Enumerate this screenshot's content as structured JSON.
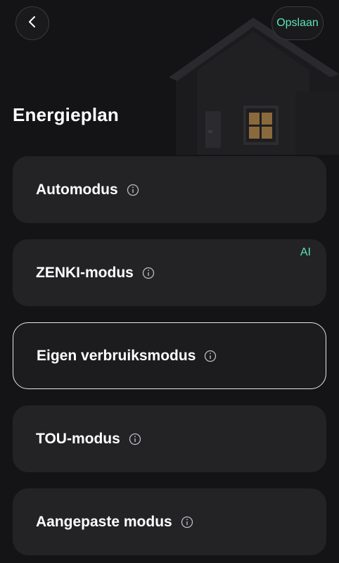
{
  "header": {
    "back_icon": "chevron-left-icon",
    "save_label": "Opslaan"
  },
  "page": {
    "title": "Energieplan"
  },
  "modes": [
    {
      "label": "Automodus",
      "icon": "info-icon",
      "selected": false
    },
    {
      "label": "ZENKI-modus",
      "icon": "info-icon",
      "badge": "AI",
      "selected": false
    },
    {
      "label": "Eigen verbruiksmodus",
      "icon": "info-icon",
      "selected": true
    },
    {
      "label": "TOU-modus",
      "icon": "info-icon",
      "selected": false
    },
    {
      "label": "Aangepaste modus",
      "icon": "info-icon",
      "selected": false
    }
  ],
  "colors": {
    "background": "#141416",
    "card": "#232326",
    "accent": "#5fe3b4",
    "selected_border": "#e6e6e8"
  }
}
